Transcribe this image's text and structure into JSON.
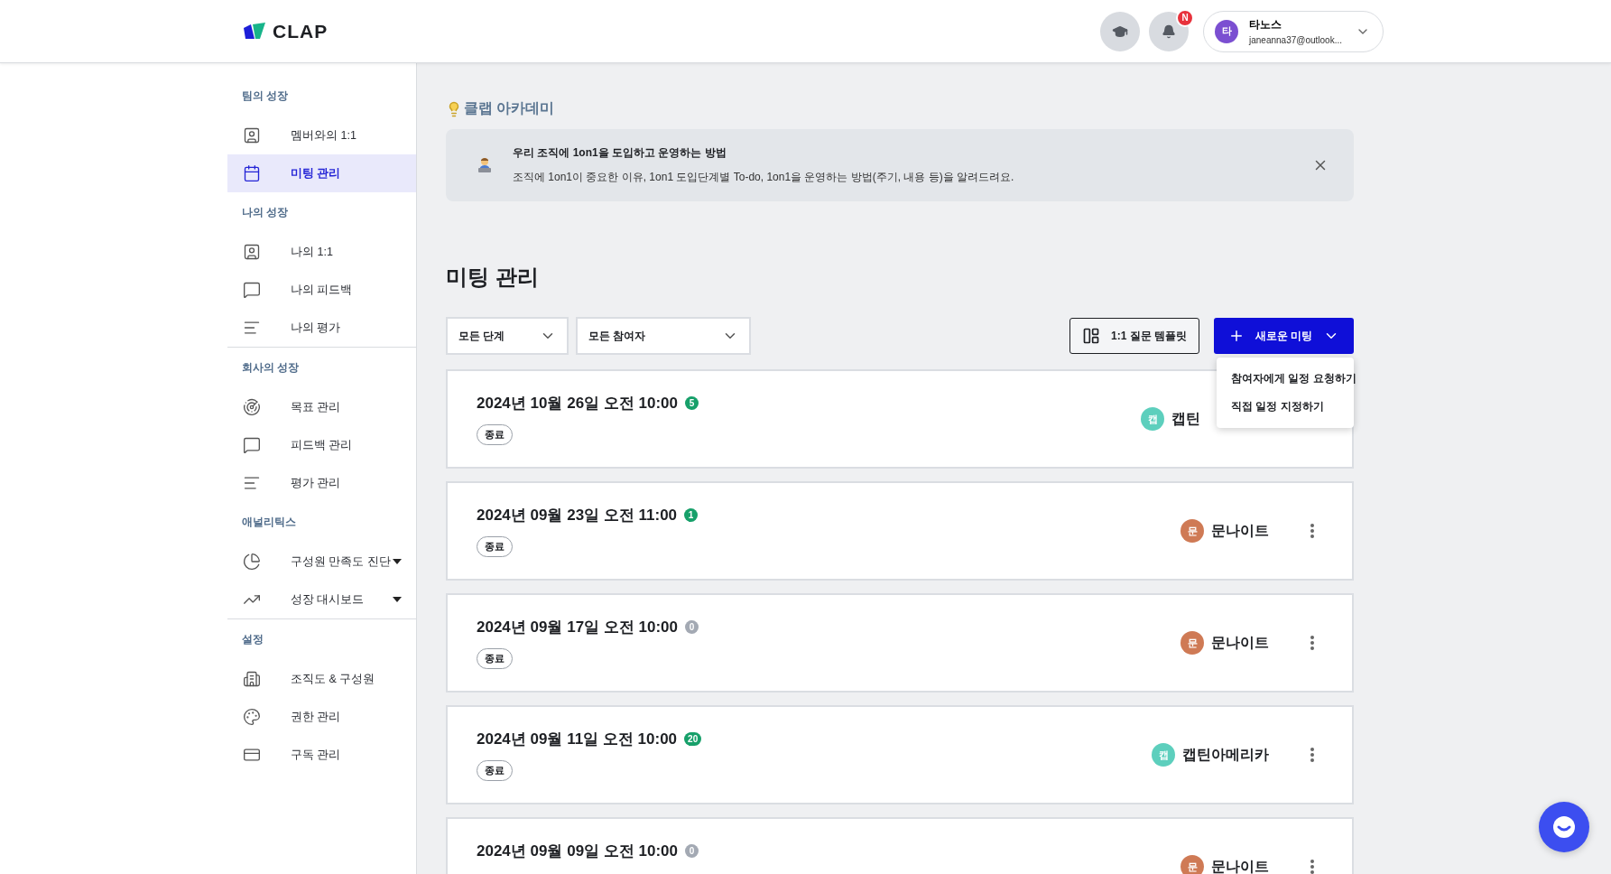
{
  "header": {
    "logo": "CLAP",
    "notification_badge": "N",
    "user": {
      "avatar": "타",
      "name": "타노스",
      "email": "janeanna37@outlook..."
    }
  },
  "sidebar": {
    "sections": [
      {
        "title": "팀의 성장",
        "divider": false,
        "items": [
          {
            "label": "멤버와의 1:1",
            "selected": false,
            "expandable": false
          },
          {
            "label": "미팅 관리",
            "selected": true,
            "expandable": false
          }
        ]
      },
      {
        "title": "나의 성장",
        "divider": false,
        "items": [
          {
            "label": "나의 1:1",
            "selected": false,
            "expandable": false
          },
          {
            "label": "나의 피드백",
            "selected": false,
            "expandable": false
          },
          {
            "label": "나의 평가",
            "selected": false,
            "expandable": false
          }
        ]
      },
      {
        "title": "회사의 성장",
        "divider": true,
        "items": [
          {
            "label": "목표 관리",
            "selected": false,
            "expandable": false
          },
          {
            "label": "피드백 관리",
            "selected": false,
            "expandable": false
          },
          {
            "label": "평가 관리",
            "selected": false,
            "expandable": false
          }
        ]
      },
      {
        "title": "애널리틱스",
        "divider": false,
        "items": [
          {
            "label": "구성원 만족도 진단",
            "selected": false,
            "expandable": true
          },
          {
            "label": "성장 대시보드",
            "selected": false,
            "expandable": true
          }
        ]
      },
      {
        "title": "설정",
        "divider": true,
        "items": [
          {
            "label": "조직도 & 구성원",
            "selected": false,
            "expandable": false
          },
          {
            "label": "권한 관리",
            "selected": false,
            "expandable": false
          },
          {
            "label": "구독 관리",
            "selected": false,
            "expandable": false
          }
        ]
      }
    ]
  },
  "academy": {
    "title": "클랩 아카데미",
    "banner": {
      "title": "우리 조직에 1on1을 도입하고 운영하는 방법",
      "description": "조직에 1on1이 중요한 이유, 1on1 도입단계별 To-do, 1on1을 운영하는 방법(주기, 내용 등)을 알려드려요."
    }
  },
  "page_title": "미팅 관리",
  "filters": [
    {
      "value": "모든 단계"
    },
    {
      "value": "모든 참여자"
    }
  ],
  "template_button": "1:1 질문 템플릿",
  "new_meeting_button": "새로운 미팅",
  "new_meeting_menu": [
    {
      "label": "참여자에게 일정 요청하기"
    },
    {
      "label": "직접 일정 지정하기"
    }
  ],
  "meetings": [
    {
      "date": "2024년 10월 26일 오전 10:00",
      "count": "5",
      "count_active": true,
      "status": "종료",
      "participant": {
        "avatar": "캡",
        "name": "캡틴",
        "color": "#5dcfbd"
      },
      "more_button": false
    },
    {
      "date": "2024년 09월 23일 오전 11:00",
      "count": "1",
      "count_active": true,
      "status": "종료",
      "participant": {
        "avatar": "문",
        "name": "문나이트",
        "color": "#cf7a55"
      },
      "more_button": true
    },
    {
      "date": "2024년 09월 17일 오전 10:00",
      "count": "0",
      "count_active": false,
      "status": "종료",
      "participant": {
        "avatar": "문",
        "name": "문나이트",
        "color": "#cf7a55"
      },
      "more_button": true
    },
    {
      "date": "2024년 09월 11일 오전 10:00",
      "count": "20",
      "count_active": true,
      "status": "종료",
      "participant": {
        "avatar": "캡",
        "name": "캡틴아메리카",
        "color": "#5dcfbd"
      },
      "more_button": true
    },
    {
      "date": "2024년 09월 09일 오전 10:00",
      "count": "0",
      "count_active": false,
      "participant": {
        "avatar": "문",
        "name": "문나이트",
        "color": "#cf7a55"
      },
      "more_button": true
    }
  ]
}
